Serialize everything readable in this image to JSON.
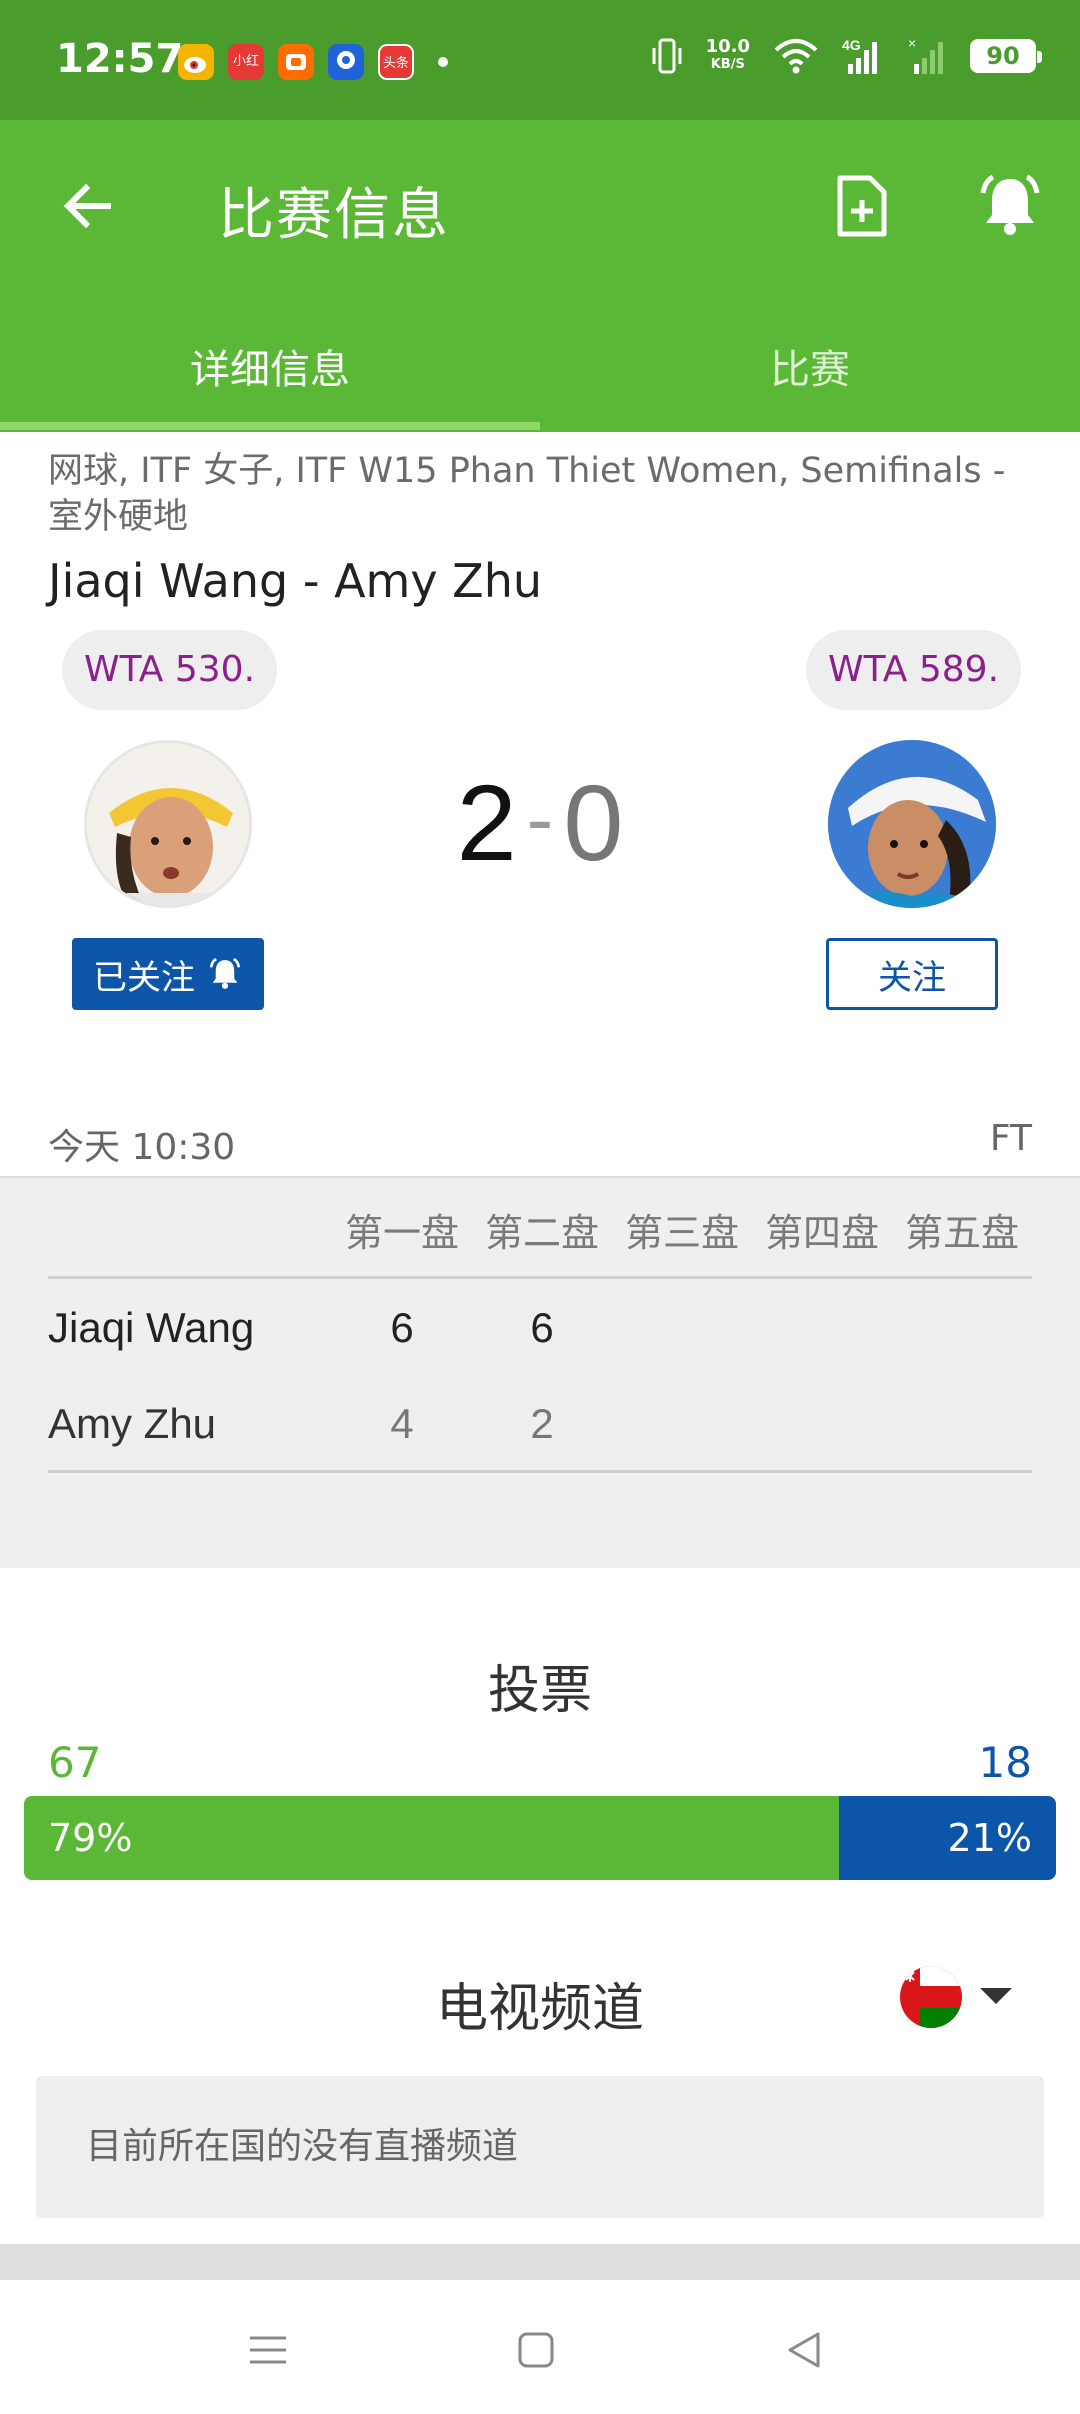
{
  "status_bar": {
    "time": "12:57",
    "apps": [
      {
        "icon": "weibo-app-icon",
        "color": "#f4b400",
        "label": ""
      },
      {
        "icon": "xiaohongshu-app-icon",
        "color": "#e53935",
        "label": "小红书"
      },
      {
        "icon": "taobao-app-icon",
        "color": "#ff6d00",
        "label": ""
      },
      {
        "icon": "baidu-app-icon",
        "color": "#1e63d8",
        "label": ""
      },
      {
        "icon": "toutiao-app-icon",
        "color": "#e53935",
        "label": "头条"
      }
    ],
    "speed_value": "10.0",
    "speed_unit": "KB/S",
    "network": "4G",
    "battery": "90"
  },
  "app_bar": {
    "title": "比赛信息",
    "tabs": [
      {
        "label": "详细信息",
        "active": true
      },
      {
        "label": "比赛",
        "active": false
      }
    ]
  },
  "match": {
    "breadcrumb": "网球, ITF 女子, ITF W15 Phan Thiet Women, Semifinals - 室外硬地",
    "title": "Jiaqi Wang - Amy Zhu",
    "home": {
      "name": "Jiaqi Wang",
      "rank": "WTA 530.",
      "follow_label": "已关注",
      "sets_won": "2"
    },
    "away": {
      "name": "Amy Zhu",
      "rank": "WTA 589.",
      "follow_label": "关注",
      "sets_won": "0"
    },
    "score_separator": "-",
    "start": "今天 10:30",
    "status": "FT"
  },
  "sets_table": {
    "headers": [
      "第一盘",
      "第二盘",
      "第三盘",
      "第四盘",
      "第五盘"
    ],
    "rows": [
      {
        "player": "Jiaqi Wang",
        "scores": [
          "6",
          "6"
        ]
      },
      {
        "player": "Amy Zhu",
        "scores": [
          "4",
          "2"
        ]
      }
    ]
  },
  "vote": {
    "title": "投票",
    "home_count": "67",
    "away_count": "18",
    "home_percent_label": "79%",
    "away_percent_label": "21%",
    "home_share": 0.79,
    "home_color": "#5bb836",
    "away_color": "#0d55a9"
  },
  "tv": {
    "title": "电视频道",
    "flag_icon": "oman-flag-icon",
    "message": "目前所在国的没有直播频道"
  },
  "nav_bar": {
    "buttons": [
      "menu-icon",
      "home-square-icon",
      "back-triangle-icon"
    ]
  }
}
